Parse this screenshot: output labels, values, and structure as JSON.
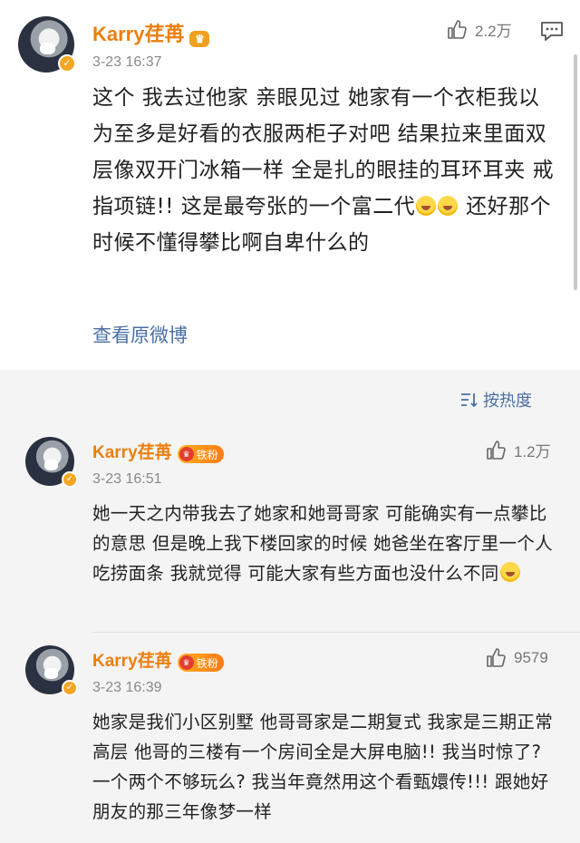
{
  "post": {
    "username": "Karry荏苒",
    "timestamp": "3-23 16:37",
    "likes": "2.2万",
    "text_before_emoji": "这个 我去过他家 亲眼见过 她家有一个衣柜我以为至多是好看的衣服两柜子对吧 结果拉来里面双层像双开门冰箱一样 全是扎的眼挂的耳环耳夹 戒指项链!! 这是最夸张的一个富二代",
    "text_after_emoji": " 还好那个时候不懂得攀比啊自卑什么的",
    "view_original": "查看原微博"
  },
  "sort": {
    "label": "按热度"
  },
  "comments": [
    {
      "username": "Karry荏苒",
      "badge": "铁粉",
      "timestamp": "3-23 16:51",
      "likes": "1.2万",
      "text": "她一天之内带我去了她家和她哥哥家 可能确实有一点攀比的意思 但是晚上我下楼回家的时候 她爸坐在客厅里一个人吃捞面条 我就觉得 可能大家有些方面也没什么不同"
    },
    {
      "username": "Karry荏苒",
      "badge": "铁粉",
      "timestamp": "3-23 16:39",
      "likes": "9579",
      "text": "她家是我们小区别墅 他哥哥家是二期复式 我家是三期正常高层 他哥的三楼有一个房间全是大屏电脑!! 我当时惊了? 一个两个不够玩么? 我当年竟然用这个看甄嬛传!!! 跟她好朋友的那三年像梦一样"
    }
  ],
  "icons": {
    "like": "thumbs-up-icon",
    "comment": "comment-icon",
    "sort": "sort-icon",
    "verified": "verified-badge-icon",
    "emoji": "laugh-cry-emoji"
  },
  "colors": {
    "username": "#ec7f0e",
    "link": "#4a6fa5",
    "badge": "#ff9a1a"
  }
}
